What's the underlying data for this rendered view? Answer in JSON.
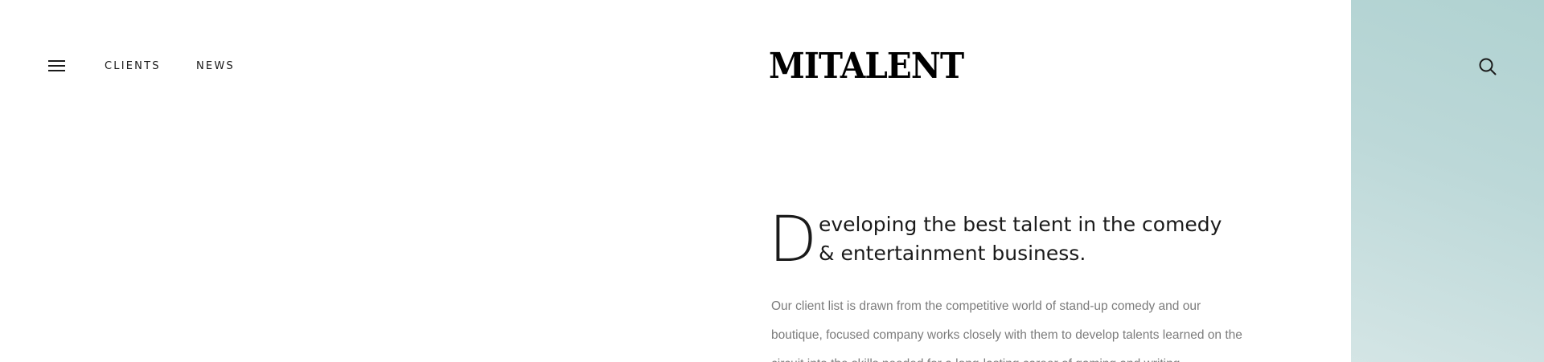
{
  "header": {
    "menu_icon": "hamburger-menu-icon",
    "nav": [
      {
        "label": "CLIENTS"
      },
      {
        "label": "NEWS"
      }
    ],
    "logo_text": "MITALENT",
    "search_icon": "search-icon"
  },
  "intro": {
    "dropcap": "D",
    "lead_line1": "eveloping the best talent in the comedy",
    "lead_line2": "& entertainment business.",
    "body": "Our client list is drawn from the competitive world of stand-up comedy and our boutique, focused company works closely with them to develop talents learned on the circuit into the skills needed for a long-lasting career of gaming and writing."
  },
  "colors": {
    "side_panel": "#b9d6d5",
    "text": "#1a1a1a",
    "body_text": "#7c7c7c"
  }
}
